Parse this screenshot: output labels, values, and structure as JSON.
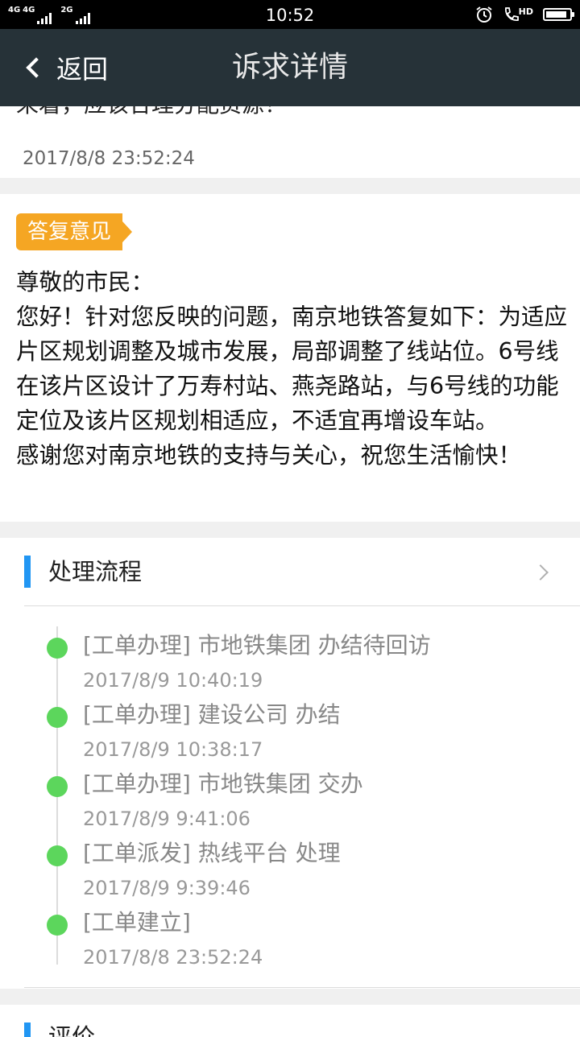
{
  "status_bar": {
    "network_left": "4G",
    "network_mid": "4G",
    "network_right": "2G",
    "time": "10:52",
    "hd_label": "HD",
    "icons": [
      "signal-icon",
      "alarm-icon",
      "phone-hd-icon",
      "battery-icon"
    ],
    "battery_level": 0.9
  },
  "nav": {
    "back_label": "返回",
    "title": "诉求详情"
  },
  "complaint": {
    "clipped_text": "来着，应该合理分配资源！",
    "timestamp": "2017/8/8 23:52:24"
  },
  "reply": {
    "tag": "答复意见",
    "lines": [
      "尊敬的市民：",
      "您好！针对您反映的问题，南京地铁答复如下：为适应片区规划调整及城市发展，局部调整了线站位。6号线在该片区设计了万寿村站、燕尧路站，与6号线的功能定位及该片区规划相适应，不适宜再增设车站。",
      "感谢您对南京地铁的支持与关心，祝您生活愉快！"
    ]
  },
  "process": {
    "title": "处理流程",
    "items": [
      {
        "title": "[工单办理] 市地铁集团 办结待回访",
        "time": "2017/8/9 10:40:19"
      },
      {
        "title": "[工单办理] 建设公司 办结",
        "time": "2017/8/9 10:38:17"
      },
      {
        "title": "[工单办理] 市地铁集团 交办",
        "time": "2017/8/9 9:41:06"
      },
      {
        "title": "[工单派发] 热线平台 处理",
        "time": "2017/8/9 9:39:46"
      },
      {
        "title": "[工单建立]",
        "time": "2017/8/8 23:52:24"
      }
    ]
  },
  "next_section": {
    "title": "评价"
  },
  "colors": {
    "navbar": "#263238",
    "tag": "#f5a623",
    "accent": "#2196f3",
    "timeline_dot": "#5cd65c"
  }
}
